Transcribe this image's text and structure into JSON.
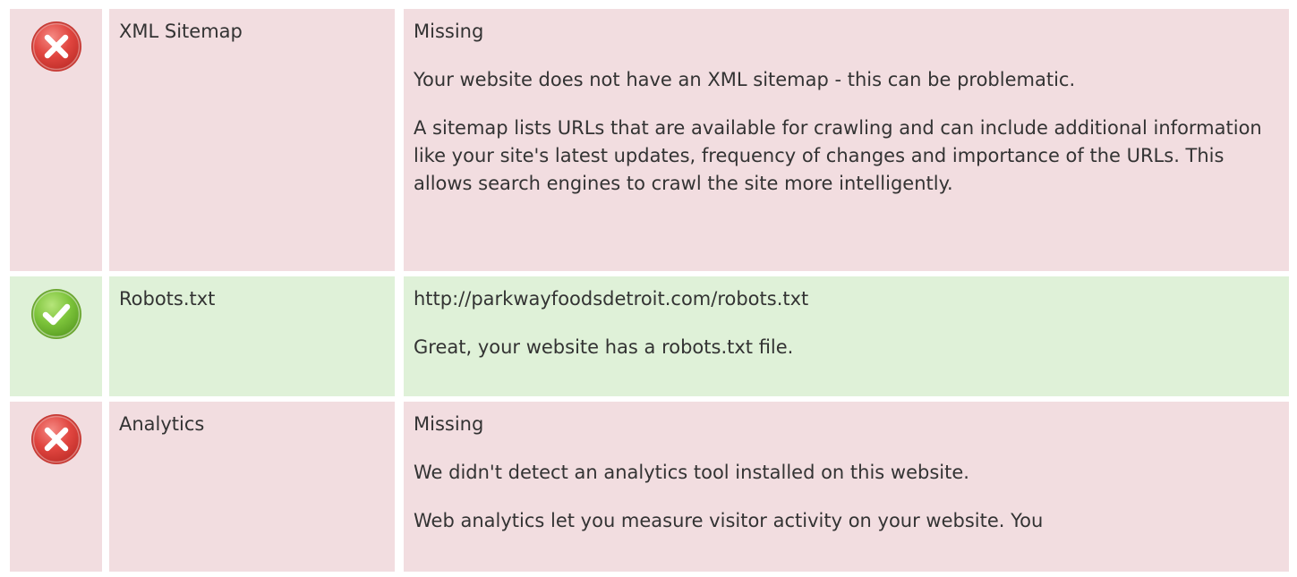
{
  "rows": [
    {
      "status": "fail",
      "icon": "error-icon",
      "name": "XML Sitemap",
      "paragraphs": [
        "Missing",
        "Your website does not have an XML sitemap - this can be problematic.",
        "A sitemap lists URLs that are available for crawling and can include additional information like your site's latest updates, frequency of changes and importance of the URLs. This allows search engines to crawl the site more intelligently."
      ]
    },
    {
      "status": "pass",
      "icon": "success-icon",
      "name": "Robots.txt",
      "paragraphs": [
        "http://parkwayfoodsdetroit.com/robots.txt",
        "Great, your website has a robots.txt file."
      ]
    },
    {
      "status": "fail",
      "icon": "error-icon",
      "name": "Analytics",
      "paragraphs": [
        "Missing",
        "We didn't detect an analytics tool installed on this website.",
        "Web analytics let you measure visitor activity on your website. You"
      ]
    }
  ],
  "colors": {
    "fail_bg": "#f2dde0",
    "pass_bg": "#dff1d8",
    "error_icon": "#e0453f",
    "success_icon": "#7cc33a"
  }
}
